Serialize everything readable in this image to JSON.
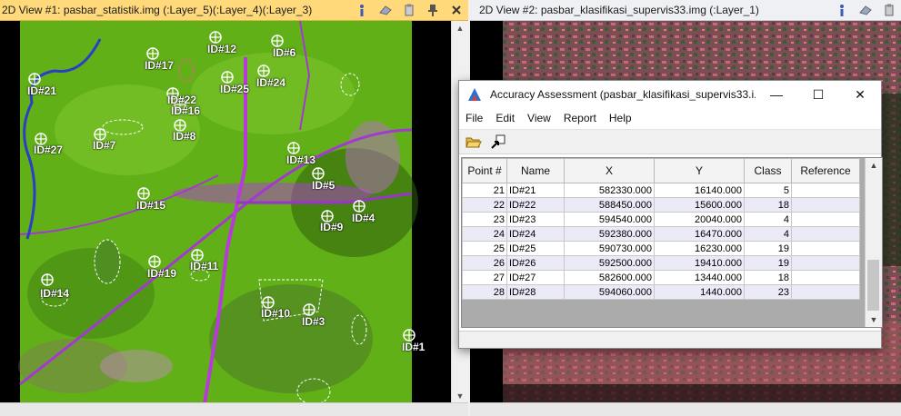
{
  "view1": {
    "title": "2D View #1: pasbar_statistik.img (:Layer_5)(:Layer_4)(:Layer_3)",
    "icons": [
      "info-icon",
      "eraser-icon",
      "clip-icon",
      "pin-icon",
      "close-icon"
    ],
    "points": [
      {
        "label": "ID#12"
      },
      {
        "label": "ID#6"
      },
      {
        "label": "ID#17"
      },
      {
        "label": "ID#25"
      },
      {
        "label": "ID#24"
      },
      {
        "label": "ID#21"
      },
      {
        "label": "ID#22"
      },
      {
        "label": "ID#16"
      },
      {
        "label": "ID#8"
      },
      {
        "label": "ID#27"
      },
      {
        "label": "ID#7"
      },
      {
        "label": "ID#13"
      },
      {
        "label": "ID#5"
      },
      {
        "label": "ID#15"
      },
      {
        "label": "ID#4"
      },
      {
        "label": "ID#9"
      },
      {
        "label": "ID#11"
      },
      {
        "label": "ID#19"
      },
      {
        "label": "ID#14"
      },
      {
        "label": "ID#10"
      },
      {
        "label": "ID#3"
      },
      {
        "label": "ID#1"
      }
    ]
  },
  "view2": {
    "title": "2D View #2: pasbar_klasifikasi_supervis33.img (:Layer_1)",
    "icons": [
      "info-icon",
      "eraser-icon",
      "clip-icon"
    ]
  },
  "dialog": {
    "title": "Accuracy Assessment (pasbar_klasifikasi_supervis33.i...",
    "window_buttons": [
      "—",
      "☐",
      "✕"
    ],
    "menu": [
      "File",
      "Edit",
      "View",
      "Report",
      "Help"
    ],
    "toolbar": [
      "open-folder-icon",
      "select-arrow-icon"
    ],
    "columns": [
      "Point #",
      "Name",
      "X",
      "Y",
      "Class",
      "Reference"
    ],
    "rows": [
      {
        "num": "21",
        "name": "ID#21",
        "x": "582330.000",
        "y": "16140.000",
        "cls": "5",
        "ref": ""
      },
      {
        "num": "22",
        "name": "ID#22",
        "x": "588450.000",
        "y": "15600.000",
        "cls": "18",
        "ref": ""
      },
      {
        "num": "23",
        "name": "ID#23",
        "x": "594540.000",
        "y": "20040.000",
        "cls": "4",
        "ref": ""
      },
      {
        "num": "24",
        "name": "ID#24",
        "x": "592380.000",
        "y": "16470.000",
        "cls": "4",
        "ref": ""
      },
      {
        "num": "25",
        "name": "ID#25",
        "x": "590730.000",
        "y": "16230.000",
        "cls": "19",
        "ref": ""
      },
      {
        "num": "26",
        "name": "ID#26",
        "x": "592500.000",
        "y": "19410.000",
        "cls": "19",
        "ref": ""
      },
      {
        "num": "27",
        "name": "ID#27",
        "x": "582600.000",
        "y": "13440.000",
        "cls": "18",
        "ref": ""
      },
      {
        "num": "28",
        "name": "ID#28",
        "x": "594060.000",
        "y": "1440.000",
        "cls": "23",
        "ref": ""
      }
    ]
  },
  "colors": {
    "active_title": "#ffd97a",
    "vegetation": "#6fc21b",
    "urban": "#b23cd6",
    "river": "#2a3fc8",
    "classified_bg": "#7a4e55"
  }
}
